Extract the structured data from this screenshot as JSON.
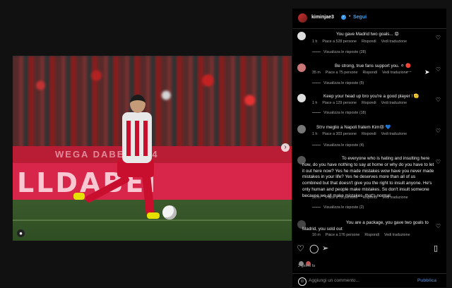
{
  "post": {
    "banner_top": "WEGA DABEI 2014",
    "banner_main": "LLDABEI"
  },
  "header": {
    "username": "kiminjae3",
    "verified": "✓",
    "separator": "•",
    "follow_label": "Segui"
  },
  "comments": [
    {
      "text": "You gave Madrid two goals... 😡",
      "time": "1 h",
      "likes": "Piace a 528 persone",
      "reply": "Rispondi",
      "translate": "Vedi traduzione",
      "replies": "Visualizza le risposte (28)"
    },
    {
      "text": "Be strong, true fans support you. ⚪ 🔴",
      "time": "35 m",
      "likes": "Piace a 75 persone",
      "reply": "Rispondi",
      "translate": "Vedi traduzione",
      "more": "···",
      "replies": "Visualizza le risposte (5)"
    },
    {
      "text": "Keep your head up bro you're a good player ! 🫡",
      "time": "1 h",
      "likes": "Piace a 129 persone",
      "reply": "Rispondi",
      "translate": "Vedi traduzione",
      "replies": "Visualizza le risposte (18)"
    },
    {
      "text": "Stтv meglio a Napoli fratem Kim😢 💙",
      "time": "1 h",
      "likes": "Piace a 303 persone",
      "reply": "Rispondi",
      "translate": "Vedi traduzione",
      "replies": "Visualizza le risposte (4)"
    },
    {
      "text": "To everyone who is hating and insulting here now, do you have nothing to say at home or why do you have to let it out here now? Yes he made mistakes wow have you never made mistakes in your life? Yes he deserves more than all of us combined but that doesn't give you the right to insult anyone. He's only human and people make mistakes. So don't insult someone because we all make mistakes, that's normal",
      "time": "36 m",
      "likes": "Piace a 70 persone",
      "reply": "Rispondi",
      "translate": "Vedi traduzione",
      "replies": "Visualizza le risposte (2)"
    },
    {
      "text": "You are a package, you gave two goals to Madrid, you sold out",
      "time": "16 m",
      "likes": "Piace a 176 persone",
      "reply": "Rispondi",
      "translate": "Vedi traduzione"
    }
  ],
  "footer": {
    "time_ago": "2 giorni fa",
    "comment_placeholder": "Aggiungi un commento...",
    "post_label": "Pubblica"
  },
  "icons": {
    "heart": "heart-icon",
    "comment": "comment-icon",
    "share": "share-icon",
    "save": "bookmark-icon",
    "emoji": "emoji-icon"
  }
}
